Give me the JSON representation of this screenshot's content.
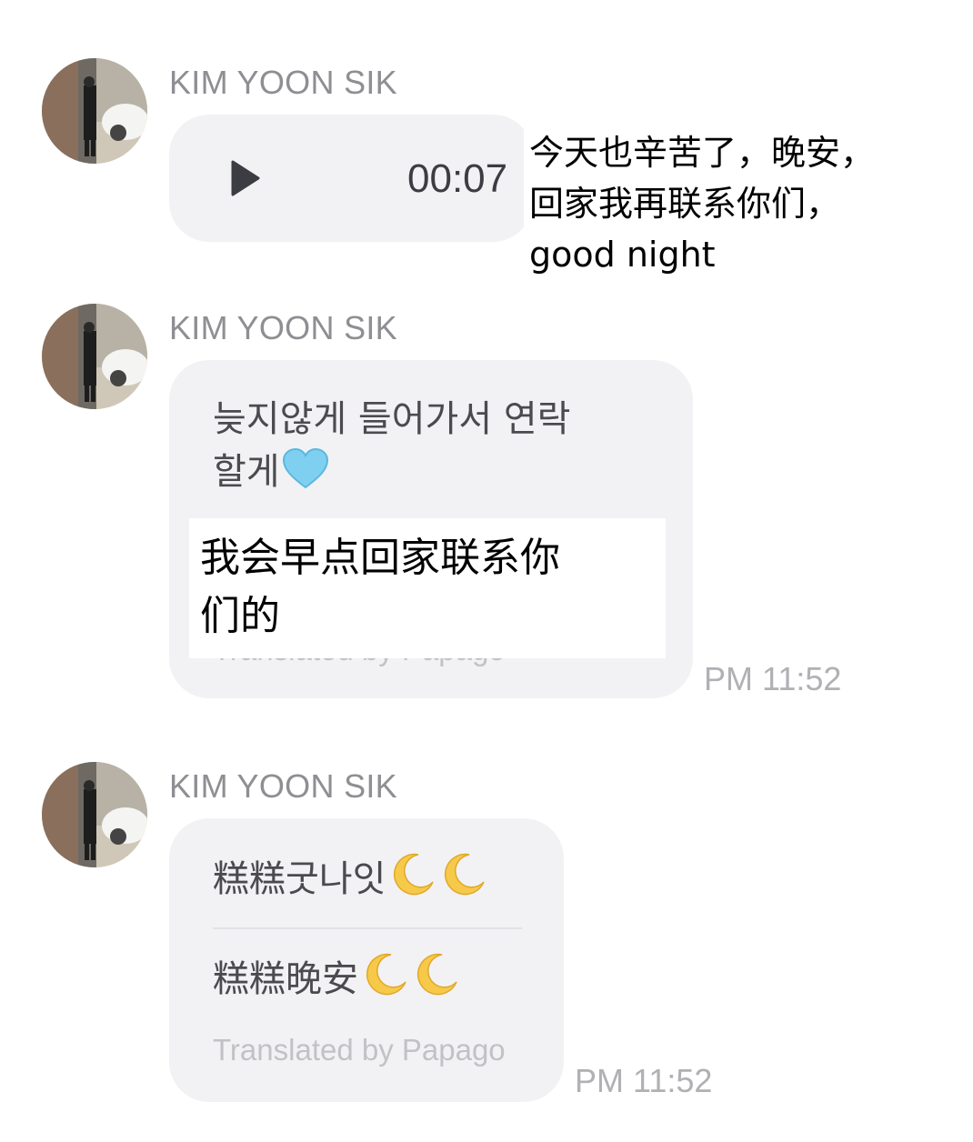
{
  "messages": [
    {
      "sender": "KIM YOON SIK",
      "type": "voice",
      "duration": "00:07",
      "overlay_caption": [
        "今天也辛苦了，晚安，",
        "回家我再联系你们，",
        "good night"
      ]
    },
    {
      "sender": "KIM YOON SIK",
      "type": "text",
      "text_line1": "늦지않게 들어가서 연락",
      "text_line2": "할게",
      "text_emoji": "light-blue-heart",
      "translation_overlay": [
        "我会早点回家联系你",
        "们的"
      ],
      "translated_by": "Translated by Papago",
      "time": "PM 11:52"
    },
    {
      "sender": "KIM YOON SIK",
      "type": "text",
      "text": "糕糕굿나잇",
      "text_emoji": "crescent-moon",
      "translation": "糕糕晚安",
      "translation_emoji": "crescent-moon",
      "translated_by": "Translated by Papago",
      "time": "PM 11:52"
    }
  ],
  "colors": {
    "bubble": "#f2f2f4",
    "sender_name": "#8e8e93",
    "timestamp": "#b0b0b5",
    "play_icon": "#3c3c43",
    "heart": "#7fd0f0",
    "moon": "#f7c948"
  }
}
